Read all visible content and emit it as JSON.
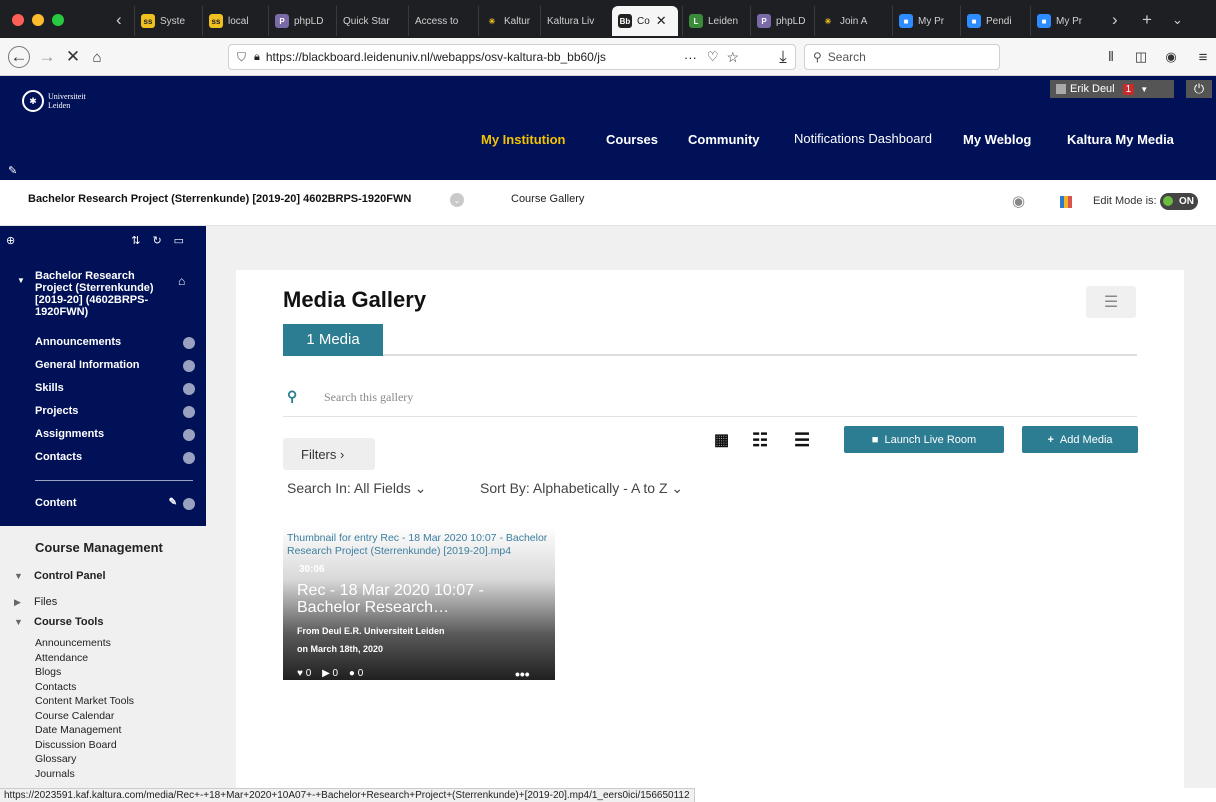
{
  "browser": {
    "tabs": [
      {
        "label": "Syste",
        "icon": "ss"
      },
      {
        "label": "local",
        "icon": "ss"
      },
      {
        "label": "phpLD",
        "icon": "php"
      },
      {
        "label": "Quick Star",
        "icon": ""
      },
      {
        "label": "Access to",
        "icon": ""
      },
      {
        "label": "Kaltur",
        "icon": "kaltura"
      },
      {
        "label": "Kaltura Liv",
        "icon": ""
      },
      {
        "label": "Co",
        "icon": "Bb"
      },
      {
        "label": "Leiden",
        "icon": "leiden"
      },
      {
        "label": "phpLD",
        "icon": "php"
      },
      {
        "label": "Join A",
        "icon": "kaltura"
      },
      {
        "label": "My Pr",
        "icon": "zoom"
      },
      {
        "label": "Pendi",
        "icon": "zoom"
      },
      {
        "label": "My Pr",
        "icon": "zoom"
      }
    ],
    "url": "https://blackboard.leidenuniv.nl/webapps/osv-kaltura-bb_bb60/js",
    "search_placeholder": "Search",
    "status_url": "https://2023591.kaf.kaltura.com/media/Rec+-+18+Mar+2020+10A07+-+Bachelor+Research+Project+(Sterrenkunde)+[2019-20].mp4/1_eers0ici/156650112"
  },
  "header": {
    "logo_line1": "Universiteit",
    "logo_line2": "Leiden",
    "user_name": "Erik Deul",
    "notif_count": "1",
    "nav": [
      "My Institution",
      "Courses",
      "Community",
      "Notifications Dashboard",
      "My Weblog",
      "Kaltura My Media"
    ]
  },
  "breadcrumb": {
    "course": "Bachelor Research Project (Sterrenkunde) [2019-20] 4602BRPS-1920FWN",
    "page": "Course Gallery",
    "edit_mode_label": "Edit Mode is:",
    "edit_mode_value": "ON"
  },
  "sidebar": {
    "course_title": "Bachelor Research Project (Sterrenkunde) [2019-20] (4602BRPS-1920FWN)",
    "items": [
      "Announcements",
      "General Information",
      "Skills",
      "Projects",
      "Assignments",
      "Contacts"
    ],
    "content_label": "Content",
    "course_management": "Course Management",
    "control_panel": "Control Panel",
    "files": "Files",
    "course_tools": "Course Tools",
    "tools": [
      "Announcements",
      "Attendance",
      "Blogs",
      "Contacts",
      "Content Market Tools",
      "Course Calendar",
      "Date Management",
      "Discussion Board",
      "Glossary",
      "Journals"
    ]
  },
  "gallery": {
    "title": "Media Gallery",
    "tab_label": "1 Media",
    "search_placeholder": "Search this gallery",
    "filters_label": "Filters ›",
    "launch_live_room": "Launch Live Room",
    "add_media": "Add Media",
    "search_in": "Search In: All Fields ⌄",
    "sort_by": "Sort By: Alphabetically - A to Z ⌄",
    "entry": {
      "alt_text": "Thumbnail for entry Rec - 18 Mar 2020 10:07 - Bachelor Research Project (Sterrenkunde) [2019-20].mp4",
      "duration": "30:06",
      "title": "Rec - 18 Mar 2020 10:07 - Bachelor Research…",
      "from": "From Deul E.R. Universiteit Leiden",
      "date": "on March 18th, 2020",
      "likes": "0",
      "plays": "0",
      "comments": "0"
    }
  },
  "colors": {
    "navy": "#001158",
    "teal": "#2c7c92",
    "gold": "#f4c300"
  }
}
